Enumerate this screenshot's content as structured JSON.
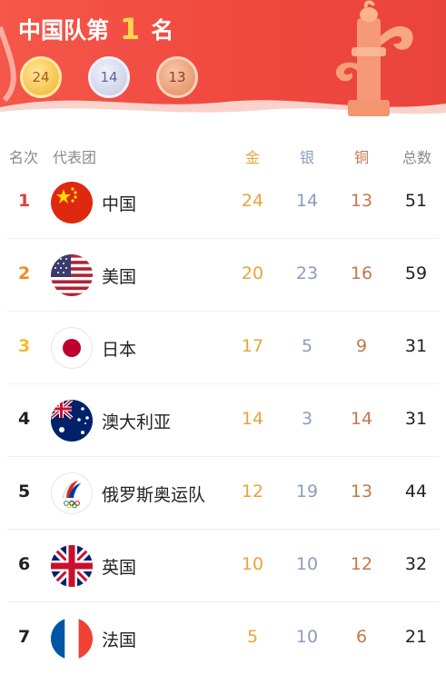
{
  "banner": {
    "title_prefix": "中国队第",
    "rank": "1",
    "title_suffix": "名",
    "medals": {
      "gold": "24",
      "silver": "14",
      "bronze": "13"
    }
  },
  "headers": {
    "rank": "名次",
    "team": "代表团",
    "gold": "金",
    "silver": "银",
    "bronze": "铜",
    "total": "总数"
  },
  "rows": [
    {
      "rank": "1",
      "flag": "china-flag-icon",
      "team": "中国",
      "gold": "24",
      "silver": "14",
      "bronze": "13",
      "total": "51"
    },
    {
      "rank": "2",
      "flag": "usa-flag-icon",
      "team": "美国",
      "gold": "20",
      "silver": "23",
      "bronze": "16",
      "total": "59"
    },
    {
      "rank": "3",
      "flag": "japan-flag-icon",
      "team": "日本",
      "gold": "17",
      "silver": "5",
      "bronze": "9",
      "total": "31"
    },
    {
      "rank": "4",
      "flag": "australia-flag-icon",
      "team": "澳大利亚",
      "gold": "14",
      "silver": "3",
      "bronze": "14",
      "total": "31"
    },
    {
      "rank": "5",
      "flag": "roc-emblem-icon",
      "team": "俄罗斯奥运队",
      "gold": "12",
      "silver": "19",
      "bronze": "13",
      "total": "44"
    },
    {
      "rank": "6",
      "flag": "uk-flag-icon",
      "team": "英国",
      "gold": "10",
      "silver": "10",
      "bronze": "12",
      "total": "32"
    },
    {
      "rank": "7",
      "flag": "france-flag-icon",
      "team": "法国",
      "gold": "5",
      "silver": "10",
      "bronze": "6",
      "total": "21"
    }
  ]
}
